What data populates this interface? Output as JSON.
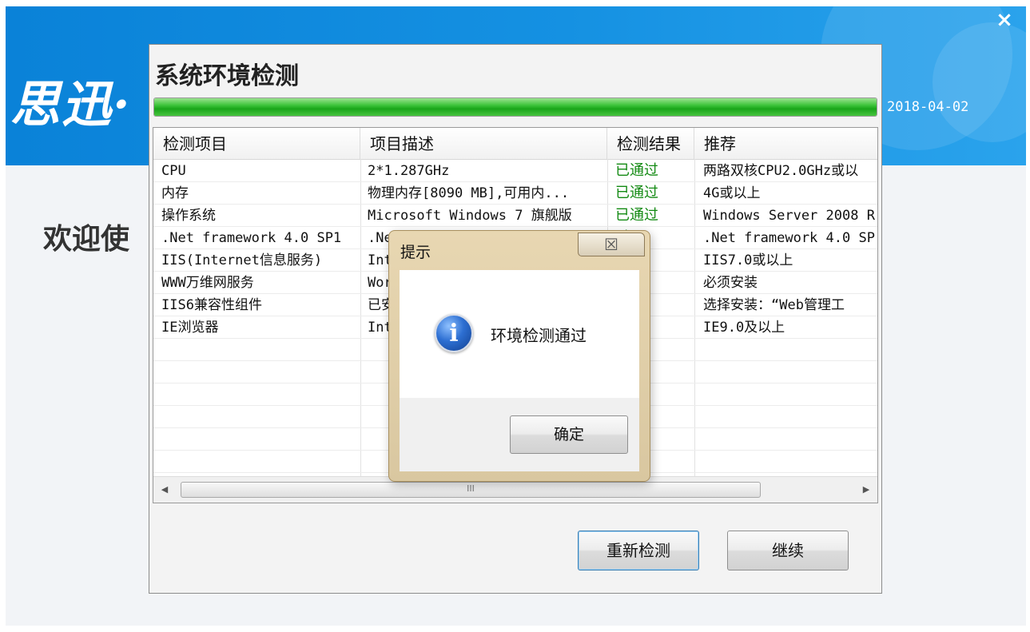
{
  "installer": {
    "logo_text": "思迅·",
    "close_glyph": "×",
    "date": "2018-04-02",
    "welcome_text": "欢迎使"
  },
  "dialog": {
    "title": "系统环境检测",
    "progress_fraction": 1.0,
    "columns": [
      "检测项目",
      "项目描述",
      "检测结果",
      "推荐"
    ],
    "rows": [
      {
        "item": "CPU",
        "desc": "2*1.287GHz",
        "result": "已通过",
        "recommend": "两路双核CPU2.0GHz或以"
      },
      {
        "item": "内存",
        "desc": "物理内存[8090 MB],可用内...",
        "result": "已通过",
        "recommend": "4G或以上"
      },
      {
        "item": "操作系统",
        "desc": "Microsoft Windows 7 旗舰版",
        "result": "已通过",
        "recommend": "Windows Server 2008 R"
      },
      {
        "item": ".Net framework 4.0 SP1",
        "desc": ".Ne",
        "result": "过",
        "recommend": ".Net framework 4.0 SP"
      },
      {
        "item": "IIS(Internet信息服务)",
        "desc": "Int",
        "result": "过",
        "recommend": "IIS7.0或以上"
      },
      {
        "item": "WWW万维网服务",
        "desc": "Wor",
        "result": "过",
        "recommend": "必须安装"
      },
      {
        "item": "IIS6兼容性组件",
        "desc": "已安",
        "result": "过",
        "recommend": "选择安装：“Web管理工"
      },
      {
        "item": "IE浏览器",
        "desc": "Int",
        "result": "过",
        "recommend": "IE9.0及以上"
      }
    ],
    "scroll_left": "◀",
    "scroll_right": "▶",
    "scroll_grip": "III",
    "recheck_label": "重新检测",
    "continue_label": "继续"
  },
  "message_box": {
    "title": "提示",
    "close_glyph": "☒",
    "icon": "info-icon",
    "icon_glyph": "i",
    "text": "环境检测通过",
    "ok_label": "确定"
  }
}
